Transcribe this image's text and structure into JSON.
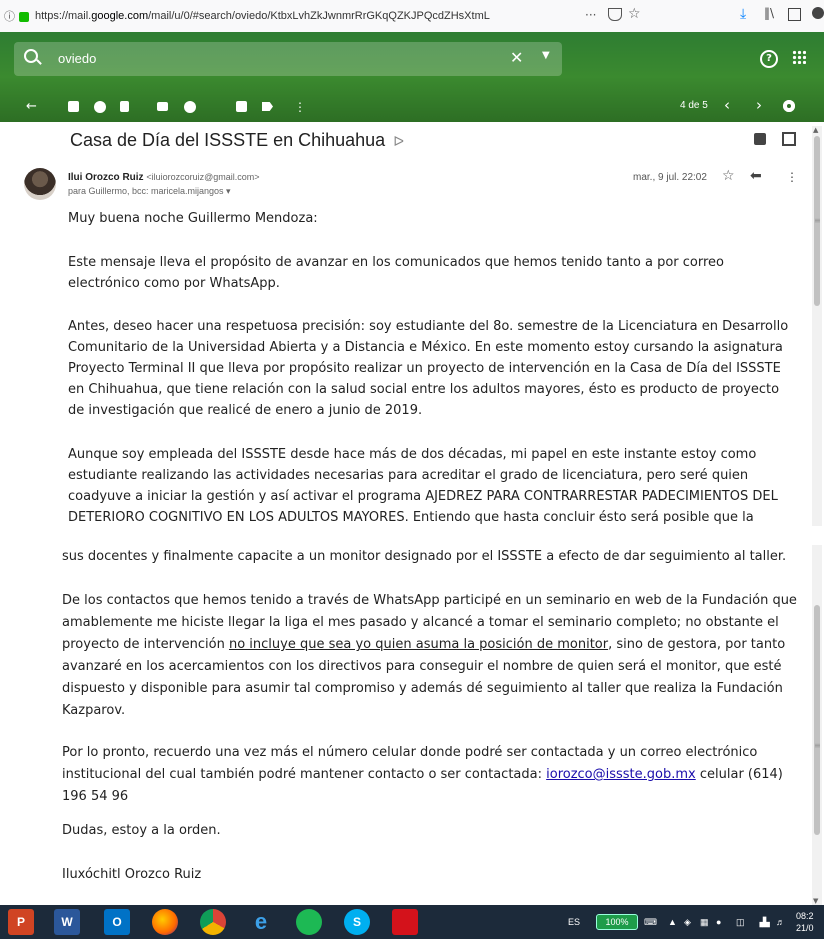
{
  "browser": {
    "url_prefix": "https://mail.",
    "url_domain": "google.com",
    "url_path": "/mail/u/0/#search/oviedo/KtbxLvhZkJwnmrRrGKqQZKJPQcdZHsXtmL",
    "more_label": "···"
  },
  "gmail": {
    "search_value": "oviedo",
    "pager": "4 de 5"
  },
  "message": {
    "subject": "Casa de Día del ISSSTE en Chihuahua",
    "sender_name": "Ilui Orozco Ruiz",
    "sender_email": "<iluiorozcoruiz@gmail.com>",
    "recipients": "para Guillermo, bcc: maricela.mijangos ▾",
    "date": "mar., 9 jul. 22:02",
    "greeting": "Muy buena noche Guillermo Mendoza:",
    "p1": "Este mensaje lleva el propósito de avanzar en los comunicados que hemos tenido tanto a por correo electrónico como por WhatsApp.",
    "p2": "Antes, deseo hacer una respetuosa precisión:  soy estudiante del 8o. semestre de la Licenciatura en Desarrollo Comunitario de la Universidad Abierta y a Distancia e México.  En este momento estoy cursando la asignatura Proyecto Terminal II que lleva por propósito realizar un proyecto de intervención en la Casa de Día del ISSSTE en Chihuahua, que tiene relación con la salud social entre los adultos mayores, ésto es producto de proyecto de investigación que realicé de enero a junio de 2019.",
    "p3": "Aunque soy empleada del ISSSTE desde hace más de dos décadas, mi papel en este instante estoy como estudiante realizando las actividades necesarias para acreditar el grado de licenciatura, pero seré quien coadyuve a iniciar la gestión y así activar el programa AJEDREZ PARA CONTRARRESTAR PADECIMIENTOS DEL DETERIORO COGNITIVO EN LOS ADULTOS MAYORES.  Entiendo que hasta concluir ésto será posible que la Fundación Kazparov se desplace con",
    "q0": "sus docentes y finalmente capacite a un monitor designado por el ISSSTE a efecto de dar seguimiento al taller.",
    "q1_a": "De los contactos que hemos tenido a través de WhatsApp participé en un seminario en web de la Fundación que amablemente me hiciste llegar la liga el mes pasado y alcancé a tomar el seminario completo; no obstante el proyecto de intervención ",
    "q1_u": "no incluye que sea yo quien asuma la posición de monitor",
    "q1_b": ", sino de gestora, por tanto avanzaré en los acercamientos con los directivos para conseguir el nombre de quien será el monitor, que esté dispuesto y disponible para asumir tal compromiso y además dé seguimiento al taller que realiza la Fundación Kazparov.",
    "q2_a": "Por lo pronto, recuerdo una vez más el número celular donde podré ser contactada y un correo electrónico institucional del cual también podré mantener contacto o ser contactada: ",
    "q2_link": "iorozco@issste.gob.mx",
    "q2_b": "   celular (614) 196 54 96",
    "q3": "Dudas, estoy a la orden.",
    "q4": "Iluxóchitl Orozco Ruiz"
  },
  "taskbar": {
    "apps": [
      "PowerPoint",
      "Word",
      "Outlook",
      "Firefox",
      "Chrome",
      "Internet Explorer",
      "Spotify",
      "Skype",
      "Acrobat"
    ],
    "lang": "ES",
    "battery": "100%",
    "time": "08:2",
    "date": "21/0"
  },
  "colors": {
    "gmail_header": "#2e7d32",
    "link": "#1a0dab",
    "taskbar": "#1c2a3a"
  }
}
